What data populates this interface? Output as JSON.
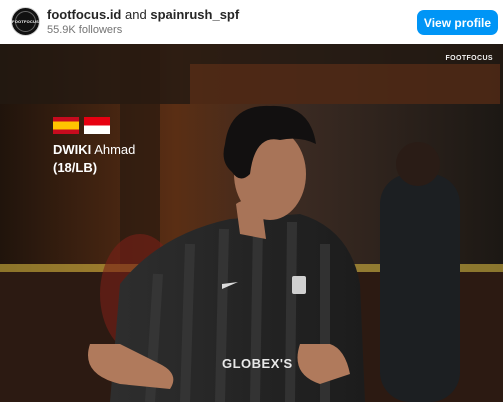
{
  "header": {
    "avatar_text": "FOOTFOCUS",
    "account": "footfocus.id",
    "connector": "and",
    "collaborator": "spainrush_spf",
    "followers": "55.9K followers",
    "view_profile_label": "View profile",
    "button_color": "#0095f6"
  },
  "photo": {
    "watermark": "FOOTFOCUS",
    "flags": [
      "spain-flag",
      "indonesia-flag"
    ],
    "player_last_name": "DWIKI",
    "player_first_name": "Ahmad",
    "player_detail": "(18/LB)",
    "jersey_sponsor": "GLOBEX'S"
  }
}
